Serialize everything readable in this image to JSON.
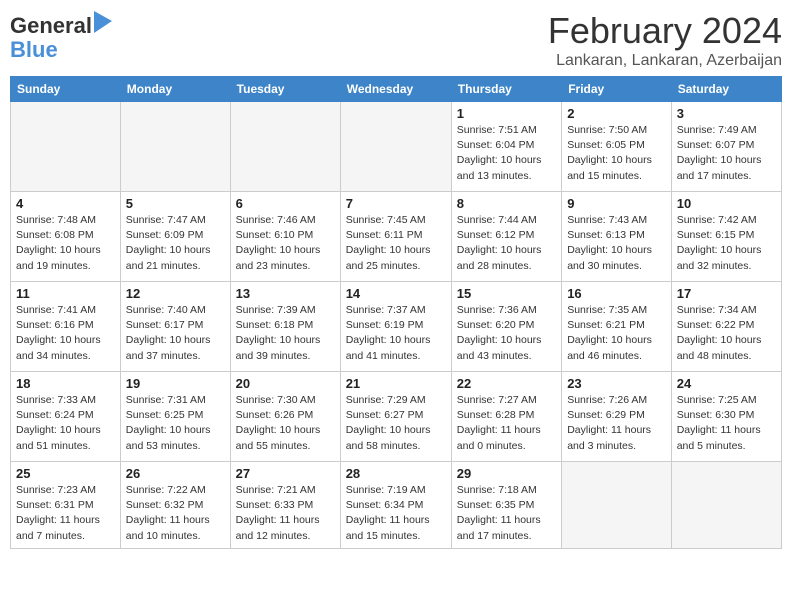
{
  "header": {
    "logo_line1": "General",
    "logo_line2": "Blue",
    "month": "February 2024",
    "location": "Lankaran, Lankaran, Azerbaijan"
  },
  "weekdays": [
    "Sunday",
    "Monday",
    "Tuesday",
    "Wednesday",
    "Thursday",
    "Friday",
    "Saturday"
  ],
  "weeks": [
    [
      {
        "day": "",
        "info": ""
      },
      {
        "day": "",
        "info": ""
      },
      {
        "day": "",
        "info": ""
      },
      {
        "day": "",
        "info": ""
      },
      {
        "day": "1",
        "info": "Sunrise: 7:51 AM\nSunset: 6:04 PM\nDaylight: 10 hours\nand 13 minutes."
      },
      {
        "day": "2",
        "info": "Sunrise: 7:50 AM\nSunset: 6:05 PM\nDaylight: 10 hours\nand 15 minutes."
      },
      {
        "day": "3",
        "info": "Sunrise: 7:49 AM\nSunset: 6:07 PM\nDaylight: 10 hours\nand 17 minutes."
      }
    ],
    [
      {
        "day": "4",
        "info": "Sunrise: 7:48 AM\nSunset: 6:08 PM\nDaylight: 10 hours\nand 19 minutes."
      },
      {
        "day": "5",
        "info": "Sunrise: 7:47 AM\nSunset: 6:09 PM\nDaylight: 10 hours\nand 21 minutes."
      },
      {
        "day": "6",
        "info": "Sunrise: 7:46 AM\nSunset: 6:10 PM\nDaylight: 10 hours\nand 23 minutes."
      },
      {
        "day": "7",
        "info": "Sunrise: 7:45 AM\nSunset: 6:11 PM\nDaylight: 10 hours\nand 25 minutes."
      },
      {
        "day": "8",
        "info": "Sunrise: 7:44 AM\nSunset: 6:12 PM\nDaylight: 10 hours\nand 28 minutes."
      },
      {
        "day": "9",
        "info": "Sunrise: 7:43 AM\nSunset: 6:13 PM\nDaylight: 10 hours\nand 30 minutes."
      },
      {
        "day": "10",
        "info": "Sunrise: 7:42 AM\nSunset: 6:15 PM\nDaylight: 10 hours\nand 32 minutes."
      }
    ],
    [
      {
        "day": "11",
        "info": "Sunrise: 7:41 AM\nSunset: 6:16 PM\nDaylight: 10 hours\nand 34 minutes."
      },
      {
        "day": "12",
        "info": "Sunrise: 7:40 AM\nSunset: 6:17 PM\nDaylight: 10 hours\nand 37 minutes."
      },
      {
        "day": "13",
        "info": "Sunrise: 7:39 AM\nSunset: 6:18 PM\nDaylight: 10 hours\nand 39 minutes."
      },
      {
        "day": "14",
        "info": "Sunrise: 7:37 AM\nSunset: 6:19 PM\nDaylight: 10 hours\nand 41 minutes."
      },
      {
        "day": "15",
        "info": "Sunrise: 7:36 AM\nSunset: 6:20 PM\nDaylight: 10 hours\nand 43 minutes."
      },
      {
        "day": "16",
        "info": "Sunrise: 7:35 AM\nSunset: 6:21 PM\nDaylight: 10 hours\nand 46 minutes."
      },
      {
        "day": "17",
        "info": "Sunrise: 7:34 AM\nSunset: 6:22 PM\nDaylight: 10 hours\nand 48 minutes."
      }
    ],
    [
      {
        "day": "18",
        "info": "Sunrise: 7:33 AM\nSunset: 6:24 PM\nDaylight: 10 hours\nand 51 minutes."
      },
      {
        "day": "19",
        "info": "Sunrise: 7:31 AM\nSunset: 6:25 PM\nDaylight: 10 hours\nand 53 minutes."
      },
      {
        "day": "20",
        "info": "Sunrise: 7:30 AM\nSunset: 6:26 PM\nDaylight: 10 hours\nand 55 minutes."
      },
      {
        "day": "21",
        "info": "Sunrise: 7:29 AM\nSunset: 6:27 PM\nDaylight: 10 hours\nand 58 minutes."
      },
      {
        "day": "22",
        "info": "Sunrise: 7:27 AM\nSunset: 6:28 PM\nDaylight: 11 hours\nand 0 minutes."
      },
      {
        "day": "23",
        "info": "Sunrise: 7:26 AM\nSunset: 6:29 PM\nDaylight: 11 hours\nand 3 minutes."
      },
      {
        "day": "24",
        "info": "Sunrise: 7:25 AM\nSunset: 6:30 PM\nDaylight: 11 hours\nand 5 minutes."
      }
    ],
    [
      {
        "day": "25",
        "info": "Sunrise: 7:23 AM\nSunset: 6:31 PM\nDaylight: 11 hours\nand 7 minutes."
      },
      {
        "day": "26",
        "info": "Sunrise: 7:22 AM\nSunset: 6:32 PM\nDaylight: 11 hours\nand 10 minutes."
      },
      {
        "day": "27",
        "info": "Sunrise: 7:21 AM\nSunset: 6:33 PM\nDaylight: 11 hours\nand 12 minutes."
      },
      {
        "day": "28",
        "info": "Sunrise: 7:19 AM\nSunset: 6:34 PM\nDaylight: 11 hours\nand 15 minutes."
      },
      {
        "day": "29",
        "info": "Sunrise: 7:18 AM\nSunset: 6:35 PM\nDaylight: 11 hours\nand 17 minutes."
      },
      {
        "day": "",
        "info": ""
      },
      {
        "day": "",
        "info": ""
      }
    ]
  ]
}
